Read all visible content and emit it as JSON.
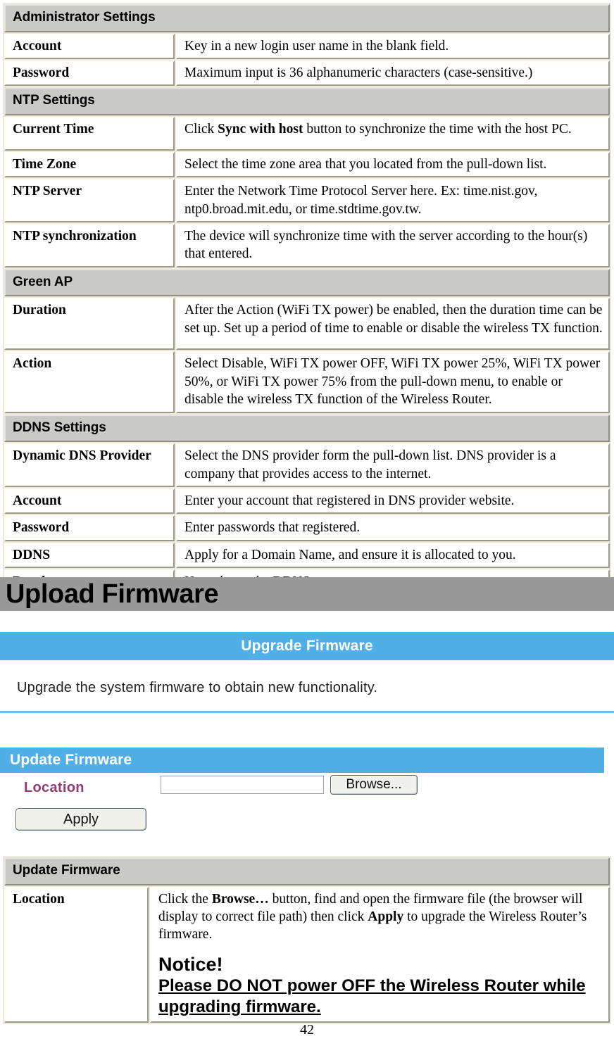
{
  "settings_table": {
    "sections": [
      {
        "heading": "Administrator Settings",
        "rows": [
          {
            "label": "Account",
            "desc_pre": "Key in a new login user name in the blank field.",
            "desc_bold": "",
            "desc_post": "",
            "tall": 0
          },
          {
            "label": "Password",
            "desc_pre": "Maximum input is 36 alphanumeric characters (case-sensitive.)",
            "desc_bold": "",
            "desc_post": "",
            "tall": 0
          }
        ]
      },
      {
        "heading": "NTP Settings",
        "rows": [
          {
            "label": "Current Time",
            "desc_pre": "Click ",
            "desc_bold": "Sync with host",
            "desc_post": " button to synchronize the time with the host PC.",
            "tall": 1
          },
          {
            "label": "Time Zone",
            "desc_pre": "Select the time zone area that you located from the pull-down list.",
            "desc_bold": "",
            "desc_post": "",
            "tall": 0
          },
          {
            "label": "NTP Server",
            "desc_pre": "Enter the Network Time Protocol Server here. Ex: time.nist.gov, ntp0.broad.mit.edu, or time.stdtime.gov.tw.",
            "desc_bold": "",
            "desc_post": "",
            "tall": 1
          },
          {
            "label": "NTP synchronization",
            "desc_pre": "The device will synchronize time with the server according to the hour(s) that entered.",
            "desc_bold": "",
            "desc_post": "",
            "tall": 1
          }
        ]
      },
      {
        "heading": "Green AP",
        "rows": [
          {
            "label": "Duration",
            "desc_pre": "After the Action (WiFi TX power) be enabled, then the duration time can be set up. Set up a period of time to enable or disable the wireless TX function.",
            "desc_bold": "",
            "desc_post": "",
            "tall": 2
          },
          {
            "label": "Action",
            "desc_pre": "Select Disable, WiFi TX power OFF, WiFi TX power 25%, WiFi TX power 50%, or WiFi TX power 75% from the pull-down menu, to enable or disable the wireless TX function of the Wireless  Router.",
            "desc_bold": "",
            "desc_post": "",
            "tall": 2
          }
        ]
      },
      {
        "heading": "DDNS Settings",
        "rows": [
          {
            "label": "Dynamic DNS Provider",
            "desc_pre": "Select the DNS provider form the pull-down list. DNS provider is a company that provides access to the internet.",
            "desc_bold": "",
            "desc_post": "",
            "tall": 1
          },
          {
            "label": "Account",
            "desc_pre": "Enter your account that registered in DNS provider website.",
            "desc_bold": "",
            "desc_post": "",
            "tall": 0
          },
          {
            "label": "Password",
            "desc_pre": "Enter passwords that registered.",
            "desc_bold": "",
            "desc_post": "",
            "tall": 0
          },
          {
            "label": "DDNS",
            "desc_pre": "Apply for a Domain Name, and ensure it is allocated to you.",
            "desc_bold": "",
            "desc_post": "",
            "tall": 0
          },
          {
            "label": "Result",
            "desc_pre": "Here shows the DDNS status.",
            "desc_bold": "",
            "desc_post": "",
            "tall": 0
          }
        ]
      }
    ]
  },
  "upload_firmware_heading": "Upload Firmware",
  "router_ui": {
    "upgrade_banner_title": "Upgrade Firmware",
    "upgrade_description": "Upgrade the system firmware to obtain new functionality.",
    "update_banner_title": "Update Firmware",
    "location_label": "Location",
    "location_value": "",
    "location_placeholder": "",
    "browse_button_label": "Browse...",
    "apply_button_label": "Apply",
    "colors": {
      "banner_blue": "#50afe7",
      "divider_blue": "#6fbfe9",
      "location_label_purple": "#973a74",
      "heading_gray": "#999999",
      "section_head_gray": "#c9c9c5"
    }
  },
  "update_table": {
    "heading": "Update Firmware",
    "row": {
      "label": "Location",
      "desc_part1": "Click the ",
      "desc_bold1": "Browse…",
      "desc_part2": " button, find and open the firmware file (the browser will display to correct file path) then click ",
      "desc_bold2": "Apply",
      "desc_part3": " to upgrade the Wireless Router’s firmware.",
      "notice_title": "Notice!",
      "notice_body": "Please DO NOT power OFF the Wireless  Router while upgrading firmware."
    }
  },
  "page_number": "42"
}
